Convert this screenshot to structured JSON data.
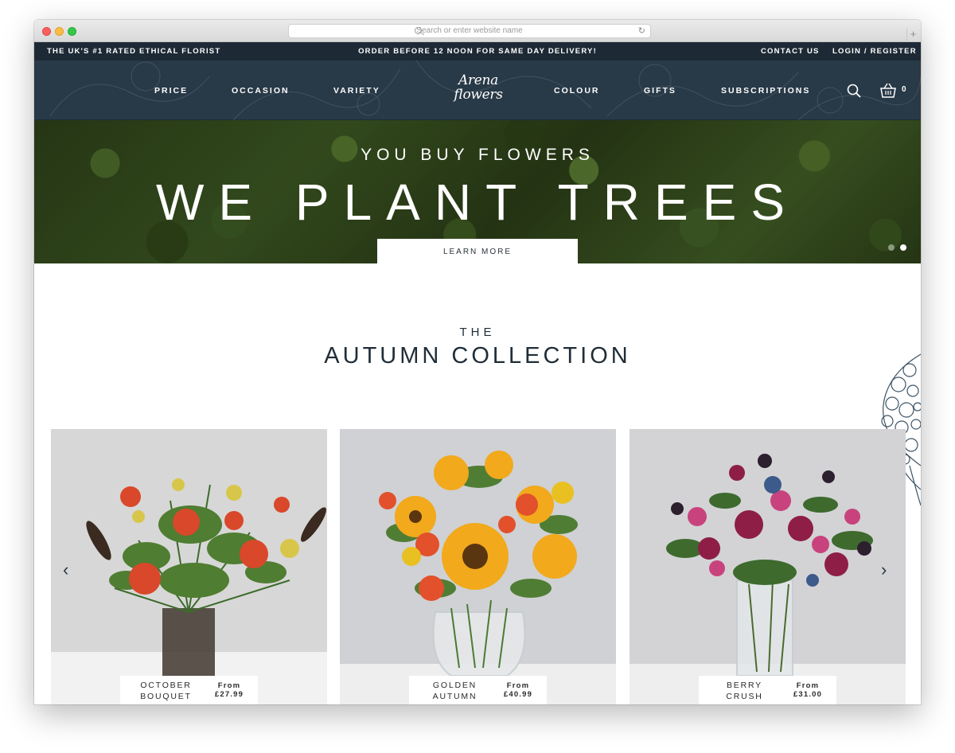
{
  "browser": {
    "url_placeholder": "Search or enter website name",
    "reload_icon": "reload-icon",
    "new_tab_label": "+"
  },
  "topstrip": {
    "tagline": "THE UK'S #1 RATED ETHICAL FLORIST",
    "promo": "ORDER BEFORE 12 NOON FOR SAME DAY DELIVERY!",
    "contact": "CONTACT US",
    "login": "LOGIN / REGISTER"
  },
  "nav": {
    "items": [
      "PRICE",
      "OCCASION",
      "VARIETY",
      "COLOUR",
      "GIFTS",
      "SUBSCRIPTIONS"
    ],
    "logo_line1": "Arena",
    "logo_line2": "flowers",
    "basket_count": "0"
  },
  "hero": {
    "subtitle": "YOU BUY FLOWERS",
    "title": "WE PLANT TREES",
    "button": "LEARN MORE"
  },
  "section": {
    "kicker": "THE",
    "title": "AUTUMN COLLECTION"
  },
  "products": [
    {
      "name_line1": "OCTOBER",
      "name_line2": "BOUQUET",
      "price_label": "From",
      "price": "£27.99"
    },
    {
      "name_line1": "GOLDEN",
      "name_line2": "AUTUMN",
      "price_label": "From",
      "price": "£40.99"
    },
    {
      "name_line1": "BERRY",
      "name_line2": "CRUSH",
      "price_label": "From",
      "price": "£31.00"
    }
  ],
  "colors": {
    "topstrip_bg": "#1d2a36",
    "nav_bg": "#283947",
    "heading": "#1f2d38"
  }
}
